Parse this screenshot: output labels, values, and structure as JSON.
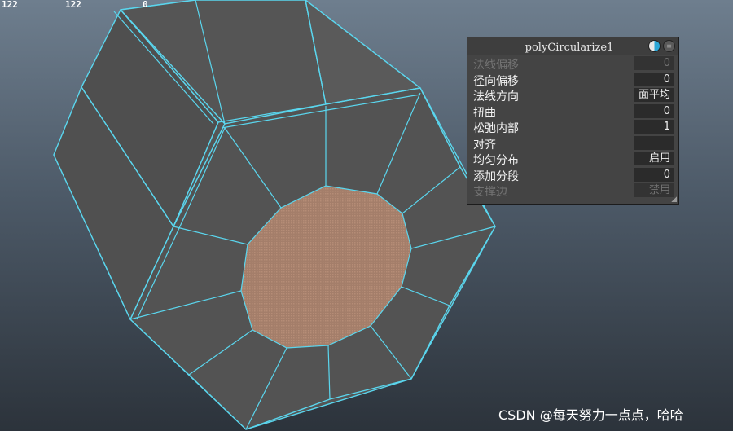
{
  "hud": {
    "col1": "122",
    "col2": "122",
    "col3": "0"
  },
  "panel": {
    "title": "polyCircularize1",
    "rows": [
      {
        "label": "法线偏移",
        "value": "0",
        "disabled": true
      },
      {
        "label": "径向偏移",
        "value": "0",
        "disabled": false
      },
      {
        "label": "法线方向",
        "value": "面平均",
        "disabled": false
      },
      {
        "label": "扭曲",
        "value": "0",
        "disabled": false
      },
      {
        "label": "松弛内部",
        "value": "1",
        "disabled": false
      },
      {
        "label": "对齐",
        "value": "",
        "disabled": false
      },
      {
        "label": "均匀分布",
        "value": "启用",
        "disabled": false
      },
      {
        "label": "添加分段",
        "value": "0",
        "disabled": false
      },
      {
        "label": "支撑边",
        "value": "禁用",
        "disabled": true
      }
    ]
  },
  "watermark": "CSDN @每天努力一点点，哈哈",
  "colors": {
    "face": "#555555",
    "wire": "#5ad6ee",
    "selected_face": "#a47e6a",
    "panel_bg": "#444444"
  }
}
